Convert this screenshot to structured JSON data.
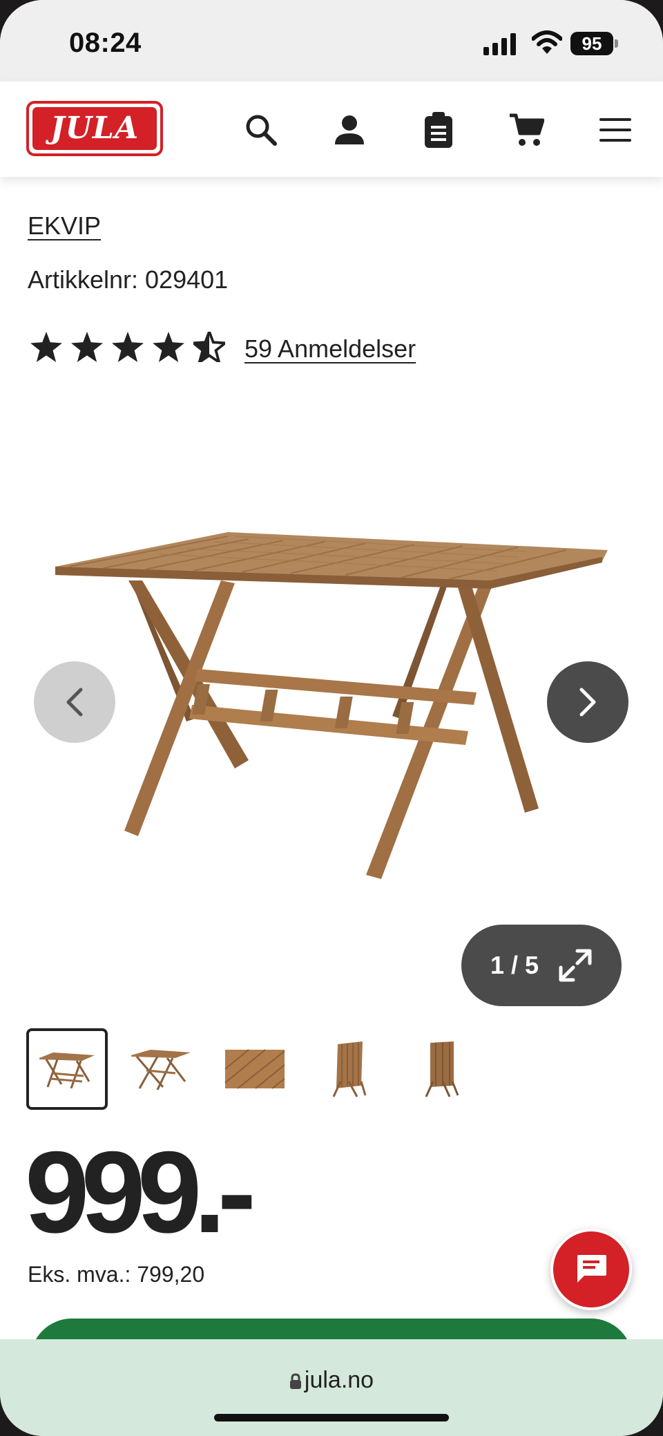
{
  "status_bar": {
    "time": "08:24",
    "battery": "95"
  },
  "header": {
    "logo_text": "JULA",
    "icons": [
      "search-icon",
      "user-icon",
      "clipboard-icon",
      "cart-icon",
      "menu-icon"
    ]
  },
  "product": {
    "brand": "EKVIP",
    "article_number": "Artikkelnr: 029401",
    "rating": 4.5,
    "reviews": "59 Anmeldelser",
    "gallery_counter": "1 / 5",
    "price": "999.-",
    "ex_vat": "Eks. mva.: 799,20"
  },
  "browser": {
    "url": "jula.no"
  },
  "colors": {
    "brand_red": "#d42027",
    "buy_green": "#1d7a3c",
    "wood": "#9a6c42"
  }
}
